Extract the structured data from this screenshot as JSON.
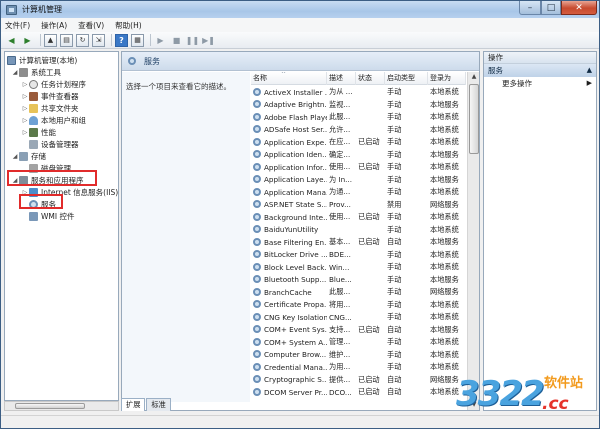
{
  "window": {
    "title": "计算机管理",
    "controls": {
      "minimize": "–",
      "maximize": "□",
      "close": "✕"
    }
  },
  "menubar": [
    "文件(F)",
    "操作(A)",
    "查看(V)",
    "帮助(H)"
  ],
  "tree": {
    "root": "计算机管理(本地)",
    "system_tools": "系统工具",
    "system_children": [
      "任务计划程序",
      "事件查看器",
      "共享文件夹",
      "本地用户和组",
      "性能",
      "设备管理器"
    ],
    "storage": "存储",
    "disk_mgmt": "磁盘管理",
    "services_apps": "服务和应用程序",
    "iis": "Internet 信息服务(IIS)管",
    "services": "服务",
    "wmi": "WMI 控件"
  },
  "middle": {
    "header": "服务",
    "description": "选择一个项目来查看它的描述。",
    "columns": {
      "name": "名称",
      "desc": "描述",
      "status": "状态",
      "startup": "启动类型",
      "logon": "登录为"
    },
    "rows": [
      {
        "name": "ActiveX Installer ...",
        "desc": "为从 ...",
        "status": "",
        "startup": "手动",
        "logon": "本地系统"
      },
      {
        "name": "Adaptive Brightn...",
        "desc": "监视...",
        "status": "",
        "startup": "手动",
        "logon": "本地服务"
      },
      {
        "name": "Adobe Flash Playe...",
        "desc": "此服...",
        "status": "",
        "startup": "手动",
        "logon": "本地系统"
      },
      {
        "name": "ADSafe Host Ser...",
        "desc": "允许...",
        "status": "",
        "startup": "手动",
        "logon": "本地系统"
      },
      {
        "name": "Application Expe...",
        "desc": "在应...",
        "status": "已启动",
        "startup": "手动",
        "logon": "本地系统"
      },
      {
        "name": "Application Iden...",
        "desc": "确定...",
        "status": "",
        "startup": "手动",
        "logon": "本地服务"
      },
      {
        "name": "Application Infor...",
        "desc": "使用...",
        "status": "已启动",
        "startup": "手动",
        "logon": "本地系统"
      },
      {
        "name": "Application Laye...",
        "desc": "为 In...",
        "status": "",
        "startup": "手动",
        "logon": "本地服务"
      },
      {
        "name": "Application Mana...",
        "desc": "为通...",
        "status": "",
        "startup": "手动",
        "logon": "本地系统"
      },
      {
        "name": "ASP.NET State S...",
        "desc": "Prov...",
        "status": "",
        "startup": "禁用",
        "logon": "网络服务"
      },
      {
        "name": "Background Inte...",
        "desc": "使用...",
        "status": "已启动",
        "startup": "手动",
        "logon": "本地系统"
      },
      {
        "name": "BaiduYunUtility",
        "desc": "",
        "status": "",
        "startup": "手动",
        "logon": "本地系统"
      },
      {
        "name": "Base Filtering En...",
        "desc": "基本...",
        "status": "已启动",
        "startup": "自动",
        "logon": "本地服务"
      },
      {
        "name": "BitLocker Drive ...",
        "desc": "BDE...",
        "status": "",
        "startup": "手动",
        "logon": "本地系统"
      },
      {
        "name": "Block Level Back...",
        "desc": "Win...",
        "status": "",
        "startup": "手动",
        "logon": "本地系统"
      },
      {
        "name": "Bluetooth Supp...",
        "desc": "Blue...",
        "status": "",
        "startup": "手动",
        "logon": "本地服务"
      },
      {
        "name": "BranchCache",
        "desc": "此服...",
        "status": "",
        "startup": "手动",
        "logon": "网络服务"
      },
      {
        "name": "Certificate Propa...",
        "desc": "将用...",
        "status": "",
        "startup": "手动",
        "logon": "本地系统"
      },
      {
        "name": "CNG Key Isolation",
        "desc": "CNG...",
        "status": "",
        "startup": "手动",
        "logon": "本地系统"
      },
      {
        "name": "COM+ Event Sys...",
        "desc": "支持...",
        "status": "已启动",
        "startup": "自动",
        "logon": "本地服务"
      },
      {
        "name": "COM+ System A...",
        "desc": "管理...",
        "status": "",
        "startup": "手动",
        "logon": "本地系统"
      },
      {
        "name": "Computer Brow...",
        "desc": "维护...",
        "status": "",
        "startup": "手动",
        "logon": "本地系统"
      },
      {
        "name": "Credential Mana...",
        "desc": "为用...",
        "status": "",
        "startup": "手动",
        "logon": "本地系统"
      },
      {
        "name": "Cryptographic S...",
        "desc": "提供...",
        "status": "已启动",
        "startup": "自动",
        "logon": "网络服务"
      },
      {
        "name": "DCOM Server Pr...",
        "desc": "DCO...",
        "status": "已启动",
        "startup": "自动",
        "logon": "本地系统"
      }
    ],
    "tabs": [
      "扩展",
      "标准"
    ]
  },
  "actions": {
    "header": "操作",
    "section": "服务",
    "item": "更多操作"
  },
  "watermark": {
    "number": "3322",
    "site": "软件站",
    "domain": ".cc"
  }
}
